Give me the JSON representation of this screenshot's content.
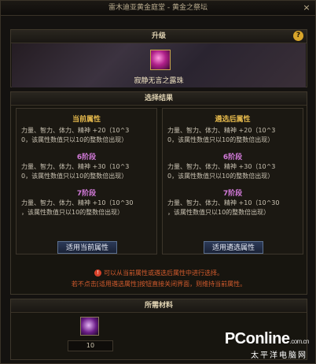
{
  "window": {
    "title": "雷木迪亚黄金庭堂 - 黄金之祭坛",
    "close_glyph": "×"
  },
  "upgrade": {
    "header": "升级",
    "help_glyph": "?",
    "item_name": "寂静无言之露珠"
  },
  "result": {
    "header": "选择结果",
    "current": {
      "title": "当前属性",
      "line1": "力量、智力、体力、精神 +20（10^3",
      "line2": "0，该属性数值只以10的整数倍出现）",
      "tier2": "6阶段",
      "line3": "力量、智力、体力、精神 +30（10^3",
      "line4": "0，该属性数值只以10的整数倍出现）",
      "tier3": "7阶段",
      "line5": "力量、智力、体力、精神 +10（10^30",
      "line6": "，该属性数值只以10的整数倍出现）",
      "button": "适用当前属性"
    },
    "after": {
      "title": "遴选后属性",
      "line1": "力量、智力、体力、精神 +20（10^3",
      "line2": "0，该属性数值只以10的整数倍出现）",
      "tier2": "6阶段",
      "line3": "力量、智力、体力、精神 +30（10^3",
      "line4": "0，该属性数值只以10的整数倍出现）",
      "tier3": "7阶段",
      "line5": "力量、智力、体力、精神 +10（10^30",
      "line6": "，该属性数值只以10的整数倍出现）",
      "button": "适用遴选属性"
    },
    "notice1": "可以从当前属性或遴选后属性中进行选择。",
    "notice2": "若不点击[适用遴选属性]按钮直接关闭界面，则维持当前属性。"
  },
  "materials": {
    "header": "所需材料",
    "quantity": "10"
  },
  "watermark": {
    "brand": "PConline",
    "domain": ".com.cn",
    "sub": "太平洋电脑网"
  },
  "colors": {
    "gold": "#e5b94c",
    "tier_purple": "#d27ad9",
    "highlight_blue": "#8ab4ff",
    "notice_red": "#d25b2d"
  }
}
